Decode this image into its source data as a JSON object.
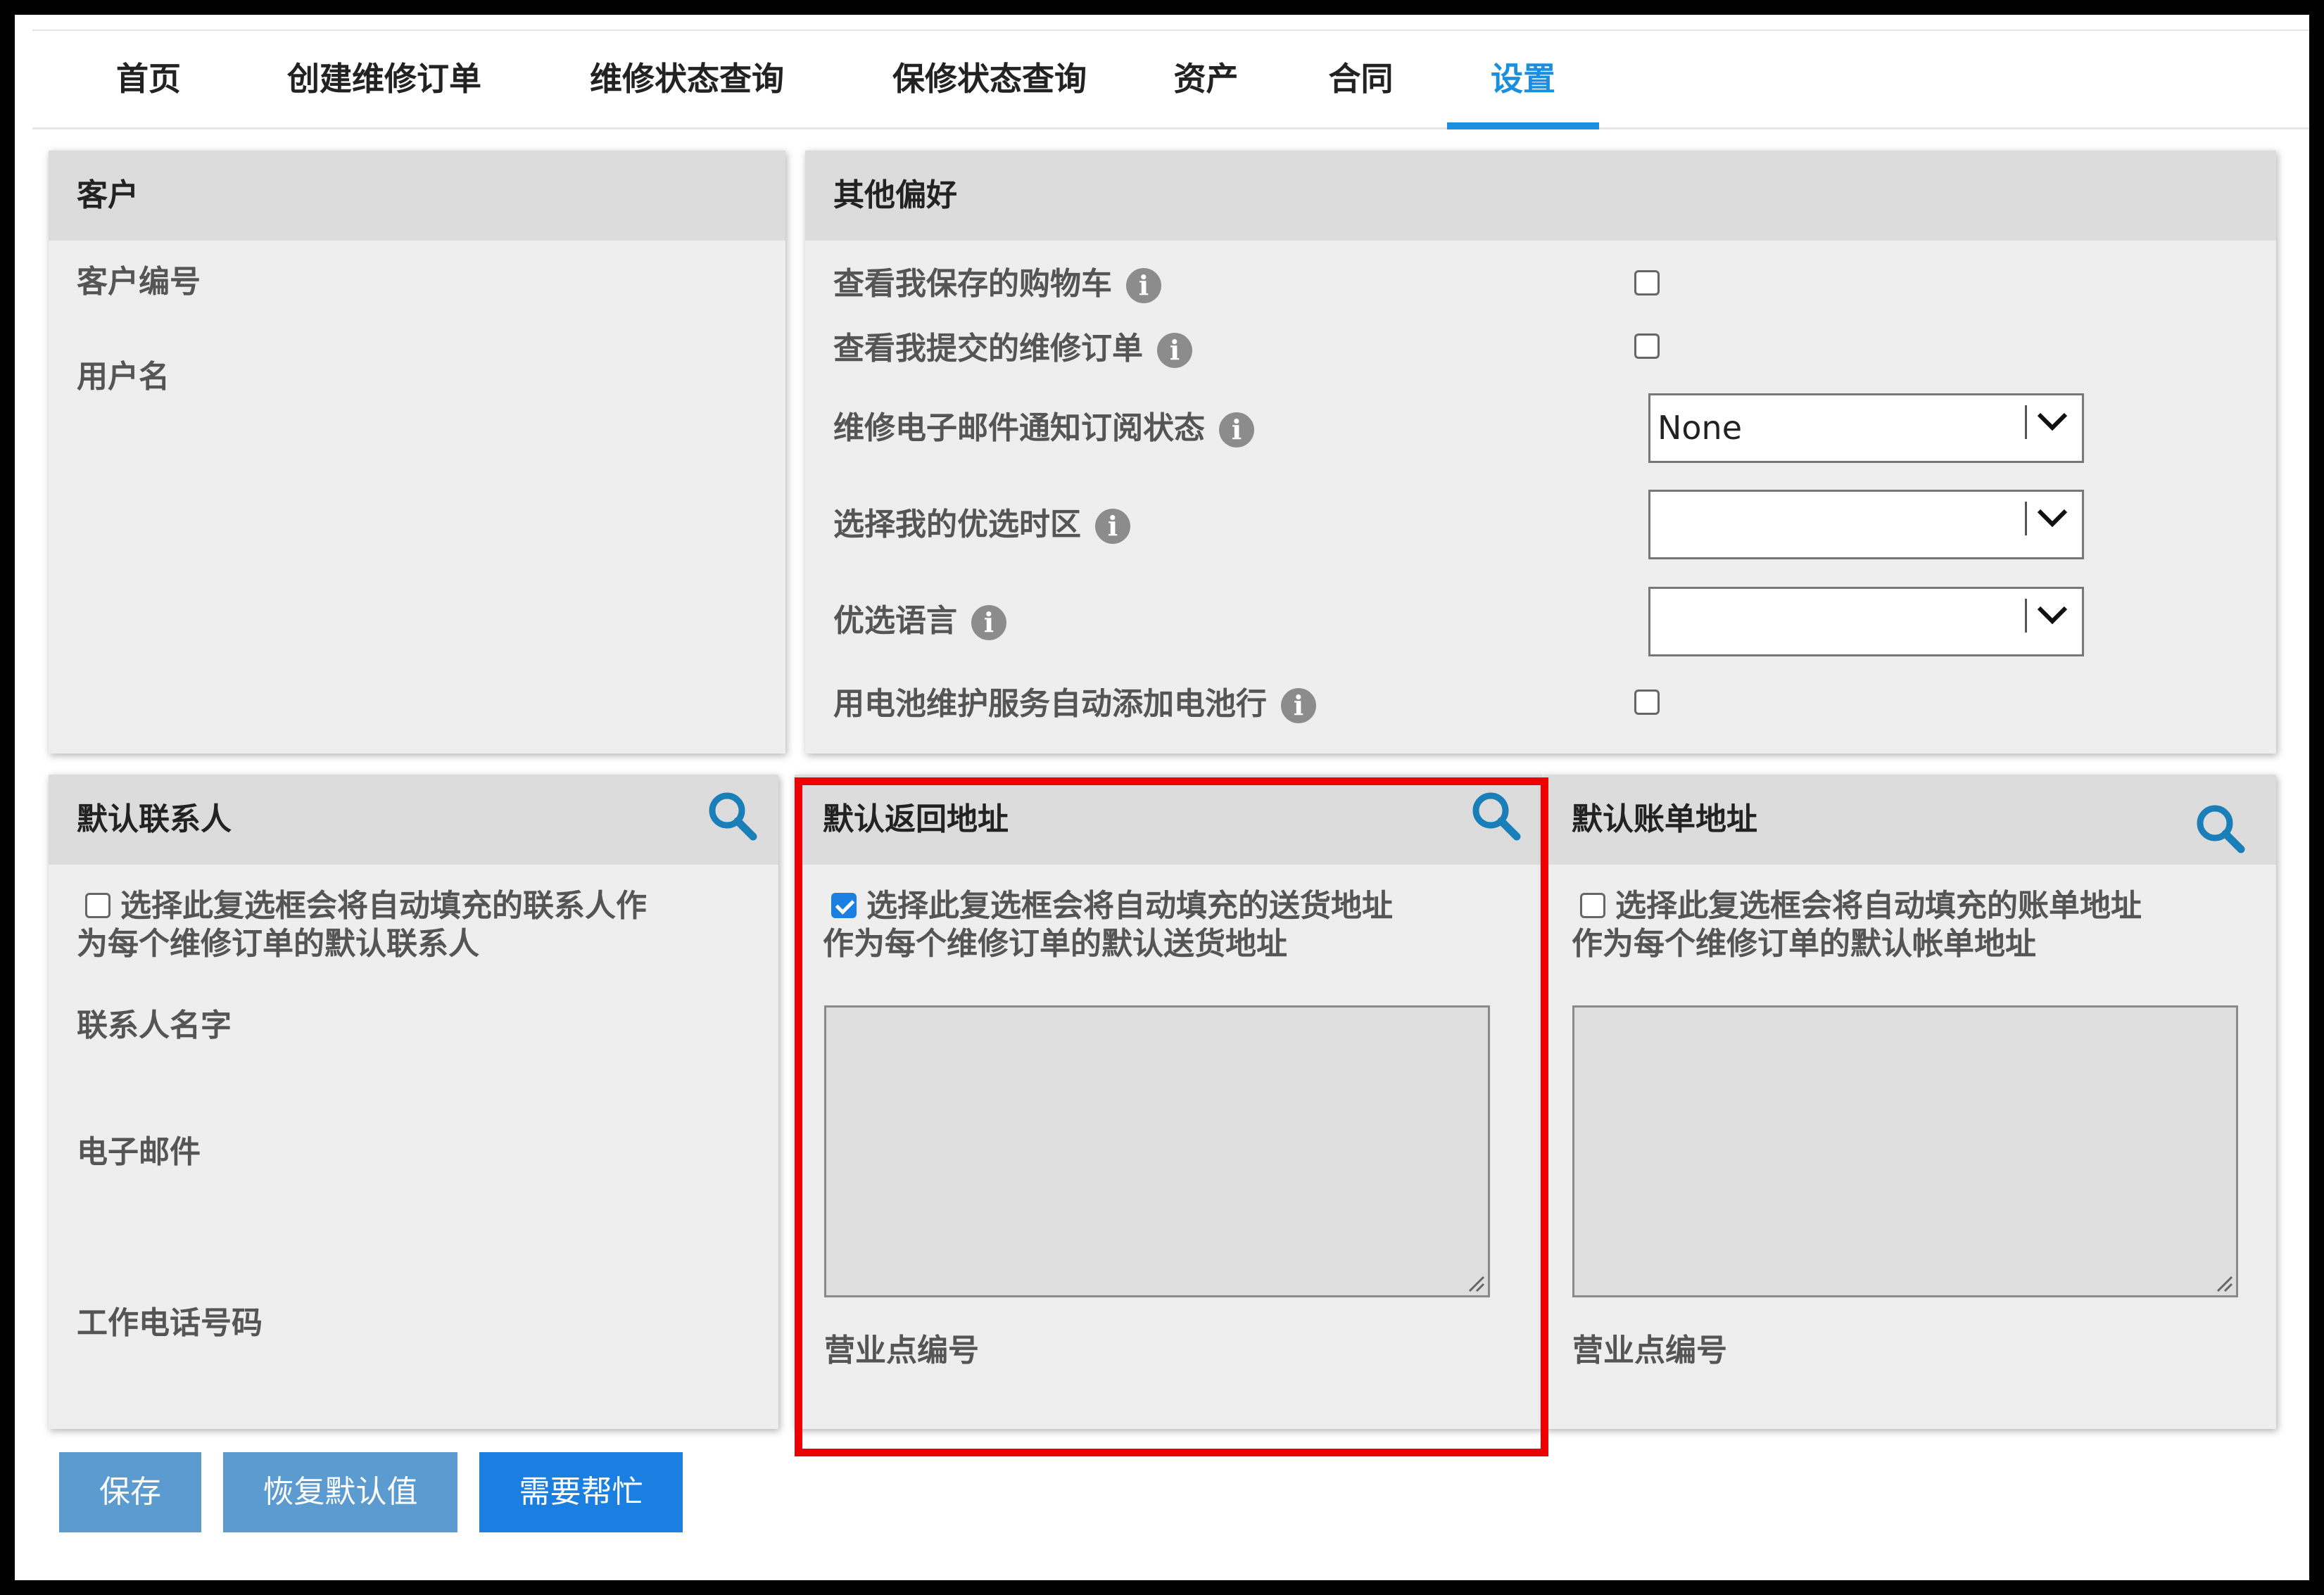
{
  "nav": {
    "items": [
      "首页",
      "创建维修订单",
      "维修状态查询",
      "保修状态查询",
      "资产",
      "合同",
      "设置"
    ],
    "active": "设置"
  },
  "customer": {
    "title": "客户",
    "customer_number_label": "客户编号",
    "username_label": "用户名"
  },
  "preferences": {
    "title": "其他偏好",
    "saved_carts_label": "查看我保存的购物车",
    "saved_carts_checked": false,
    "submitted_orders_label": "查看我提交的维修订单",
    "submitted_orders_checked": false,
    "email_status_label": "维修电子邮件通知订阅状态",
    "email_status_value": "None",
    "timezone_label": "选择我的优选时区",
    "timezone_value": "",
    "language_label": "优选语言",
    "language_value": "",
    "battery_label": "用电池维护服务自动添加电池行",
    "battery_checked": false,
    "info_icon": "i"
  },
  "default_contact": {
    "title": "默认联系人",
    "checkbox_line1": "选择此复选框会将自动填充的联系人作",
    "checkbox_line2": "为每个维修订单的默认联系人",
    "checked": false,
    "name_label": "联系人名字",
    "email_label": "电子邮件",
    "phone_label": "工作电话号码"
  },
  "return_address": {
    "title": "默认返回地址",
    "checkbox_line1": "选择此复选框会将自动填充的送货地址",
    "checkbox_line2": "作为每个维修订单的默认送货地址",
    "checked": true,
    "address_value": "",
    "site_label": "营业点编号"
  },
  "billing_address": {
    "title": "默认账单地址",
    "checkbox_line1": "选择此复选框会将自动填充的账单地址",
    "checkbox_line2": "作为每个维修订单的默认帐单地址",
    "checked": false,
    "address_value": "",
    "site_label": "营业点编号"
  },
  "buttons": {
    "save": "保存",
    "restore": "恢复默认值",
    "help": "需要帮忙"
  },
  "colors": {
    "accent": "#1a8fe0",
    "highlight": "#ee0000",
    "button_light": "#5b9bd0",
    "button_primary": "#1a7fe0"
  }
}
